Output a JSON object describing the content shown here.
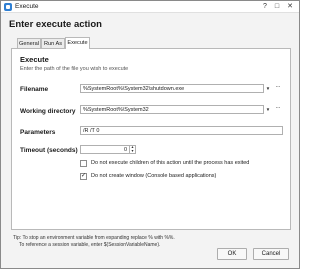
{
  "window": {
    "title": "Execute",
    "controls": {
      "help": "?",
      "maximize": "□",
      "close": "✕"
    }
  },
  "dialog": {
    "heading": "Enter execute action"
  },
  "tabs": [
    {
      "label": "General",
      "active": false
    },
    {
      "label": "Run As",
      "active": false
    },
    {
      "label": "Execute",
      "active": true
    }
  ],
  "section": {
    "title": "Execute",
    "description": "Enter the path of the file you wish to execute"
  },
  "fields": {
    "filename": {
      "label": "Filename",
      "value": "%SystemRoot%\\System32\\shutdown.exe"
    },
    "working_directory": {
      "label": "Working directory",
      "value": "%SystemRoot%\\System32"
    },
    "parameters": {
      "label": "Parameters",
      "value": "/R /T 0"
    },
    "timeout": {
      "label": "Timeout (seconds)",
      "value": "0"
    }
  },
  "options": [
    {
      "label": "Do not execute children of this action until the process has exited",
      "checked": false
    },
    {
      "label": "Do not create window (Console based applications)",
      "checked": true
    }
  ],
  "glyphs": {
    "dropdown": "▼",
    "more": "...",
    "spin_up": "▲",
    "spin_down": "▼",
    "check": "✓"
  },
  "footer": {
    "tip_line1": "Tip: To stop an environment variable from expanding replace % with %%.",
    "tip_line2": "To reference a session variable, enter $(SessionVariableName).",
    "ok_label": "OK",
    "cancel_label": "Cancel"
  },
  "colors": {
    "app_icon": "#2f7fd3",
    "panel_bg": "#ffffff",
    "dialog_bg": "#f3f3f3"
  }
}
